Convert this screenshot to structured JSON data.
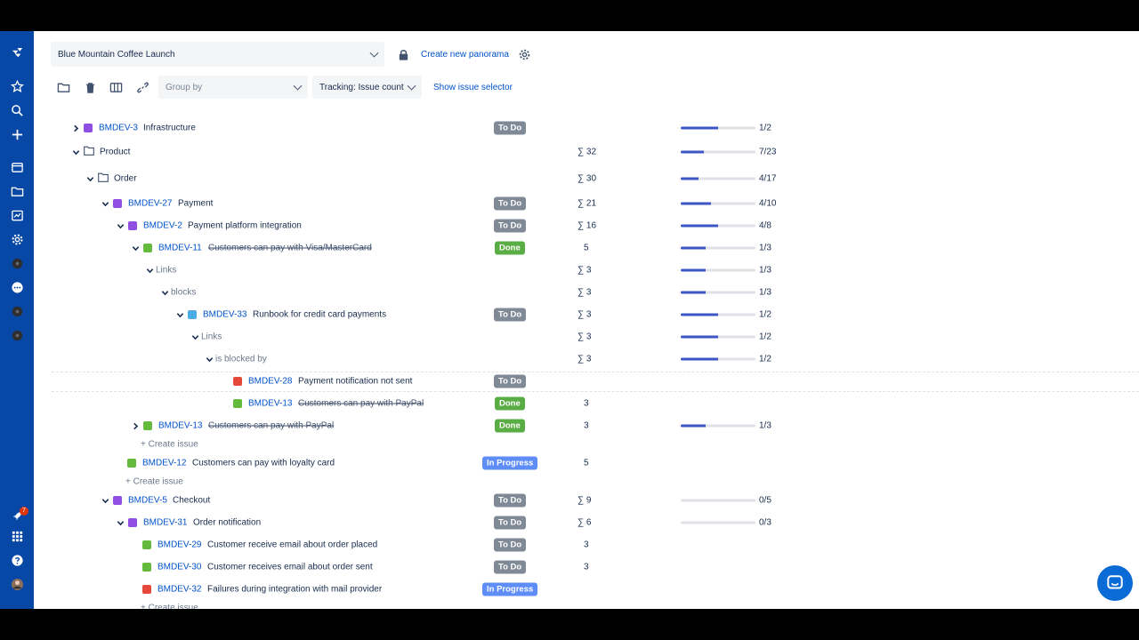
{
  "header": {
    "structure_name": "Blue Mountain Coffee Launch",
    "create_panorama": "Create new panorama"
  },
  "toolbar": {
    "group_by_placeholder": "Group by",
    "tracking": "Tracking: Issue count",
    "show_selector": "Show issue selector"
  },
  "sidebar": {
    "badge": "7"
  },
  "colors": {
    "sidebar": "#0747a6",
    "link": "#0052cc",
    "progress_fill": "#3b55c4",
    "todo": "#808a96",
    "done": "#5aac44",
    "in_progress": "#5e8df7"
  },
  "rows": [
    {
      "kind": "issue",
      "caret": "right",
      "type": "epic",
      "key": "BMDEV-3",
      "summary": "Infrastructure",
      "status": "To Do",
      "est": "",
      "progress": 0.5,
      "prog_label": "1/2"
    },
    {
      "kind": "folder",
      "caret": "down",
      "summary": "Product",
      "est": "∑ 32",
      "progress": 0.304,
      "prog_label": "7/23"
    },
    {
      "kind": "folder",
      "caret": "down",
      "summary": "Order",
      "est": "∑ 30",
      "progress": 0.235,
      "prog_label": "4/17"
    },
    {
      "kind": "issue",
      "caret": "down",
      "type": "epic",
      "key": "BMDEV-27",
      "summary": "Payment",
      "status": "To Do",
      "est": "∑ 21",
      "progress": 0.4,
      "prog_label": "4/10"
    },
    {
      "kind": "issue",
      "caret": "down",
      "type": "epic",
      "key": "BMDEV-2",
      "summary": "Payment platform integration",
      "status": "To Do",
      "est": "∑ 16",
      "progress": 0.5,
      "prog_label": "4/8"
    },
    {
      "kind": "issue",
      "caret": "down",
      "type": "story",
      "key": "BMDEV-11",
      "summary": "Customers can pay with Visa/MasterCard",
      "done": true,
      "status": "Done",
      "est": "5",
      "progress": 0.333,
      "prog_label": "1/3"
    },
    {
      "kind": "group",
      "caret": "down",
      "summary": "Links",
      "est": "∑ 3",
      "progress": 0.333,
      "prog_label": "1/3"
    },
    {
      "kind": "group",
      "caret": "down",
      "summary": "blocks",
      "est": "∑ 3",
      "progress": 0.333,
      "prog_label": "1/3"
    },
    {
      "kind": "issue",
      "caret": "down",
      "type": "task",
      "key": "BMDEV-33",
      "summary": "Runbook for credit card payments",
      "status": "To Do",
      "est": "∑ 3",
      "progress": 0.5,
      "prog_label": "1/2"
    },
    {
      "kind": "group",
      "caret": "down",
      "summary": "Links",
      "est": "∑ 3",
      "progress": 0.5,
      "prog_label": "1/2"
    },
    {
      "kind": "group",
      "caret": "down",
      "summary": "is blocked by",
      "est": "∑ 3",
      "progress": 0.5,
      "prog_label": "1/2"
    },
    {
      "kind": "issue",
      "caret": "",
      "type": "bug",
      "key": "BMDEV-28",
      "summary": "Payment notification not sent",
      "status": "To Do",
      "est": "",
      "progress": null,
      "prog_label": ""
    },
    {
      "kind": "issue",
      "caret": "",
      "type": "story",
      "key": "BMDEV-13",
      "summary": "Customers can pay with PayPal",
      "done": true,
      "status": "Done",
      "est": "3",
      "progress": null,
      "prog_label": ""
    },
    {
      "kind": "issue",
      "caret": "right",
      "type": "story",
      "key": "BMDEV-13",
      "summary": "Customers can pay with PayPal",
      "done": true,
      "status": "Done",
      "est": "3",
      "progress": 0.333,
      "prog_label": "1/3"
    },
    {
      "kind": "create",
      "summary": "+ Create issue"
    },
    {
      "kind": "issue",
      "caret": "",
      "type": "story",
      "key": "BMDEV-12",
      "summary": "Customers can pay with loyalty card",
      "status": "In Progress",
      "est": "5",
      "progress": null,
      "prog_label": ""
    },
    {
      "kind": "create",
      "summary": "+ Create issue"
    },
    {
      "kind": "issue",
      "caret": "down",
      "type": "epic",
      "key": "BMDEV-5",
      "summary": "Checkout",
      "status": "To Do",
      "est": "∑ 9",
      "progress": 0,
      "prog_label": "0/5"
    },
    {
      "kind": "issue",
      "caret": "down",
      "type": "epic",
      "key": "BMDEV-31",
      "summary": "Order notification",
      "status": "To Do",
      "est": "∑ 6",
      "progress": 0,
      "prog_label": "0/3"
    },
    {
      "kind": "issue",
      "caret": "",
      "type": "story",
      "key": "BMDEV-29",
      "summary": "Customer receive email about order placed",
      "status": "To Do",
      "est": "3",
      "progress": null,
      "prog_label": ""
    },
    {
      "kind": "issue",
      "caret": "",
      "type": "story",
      "key": "BMDEV-30",
      "summary": "Customer receives email about order sent",
      "status": "To Do",
      "est": "3",
      "progress": null,
      "prog_label": ""
    },
    {
      "kind": "issue",
      "caret": "",
      "type": "bug",
      "key": "BMDEV-32",
      "summary": "Failures during integration with mail provider",
      "status": "In Progress",
      "est": "",
      "progress": null,
      "prog_label": ""
    },
    {
      "kind": "create",
      "summary": "+ Create issue"
    }
  ]
}
